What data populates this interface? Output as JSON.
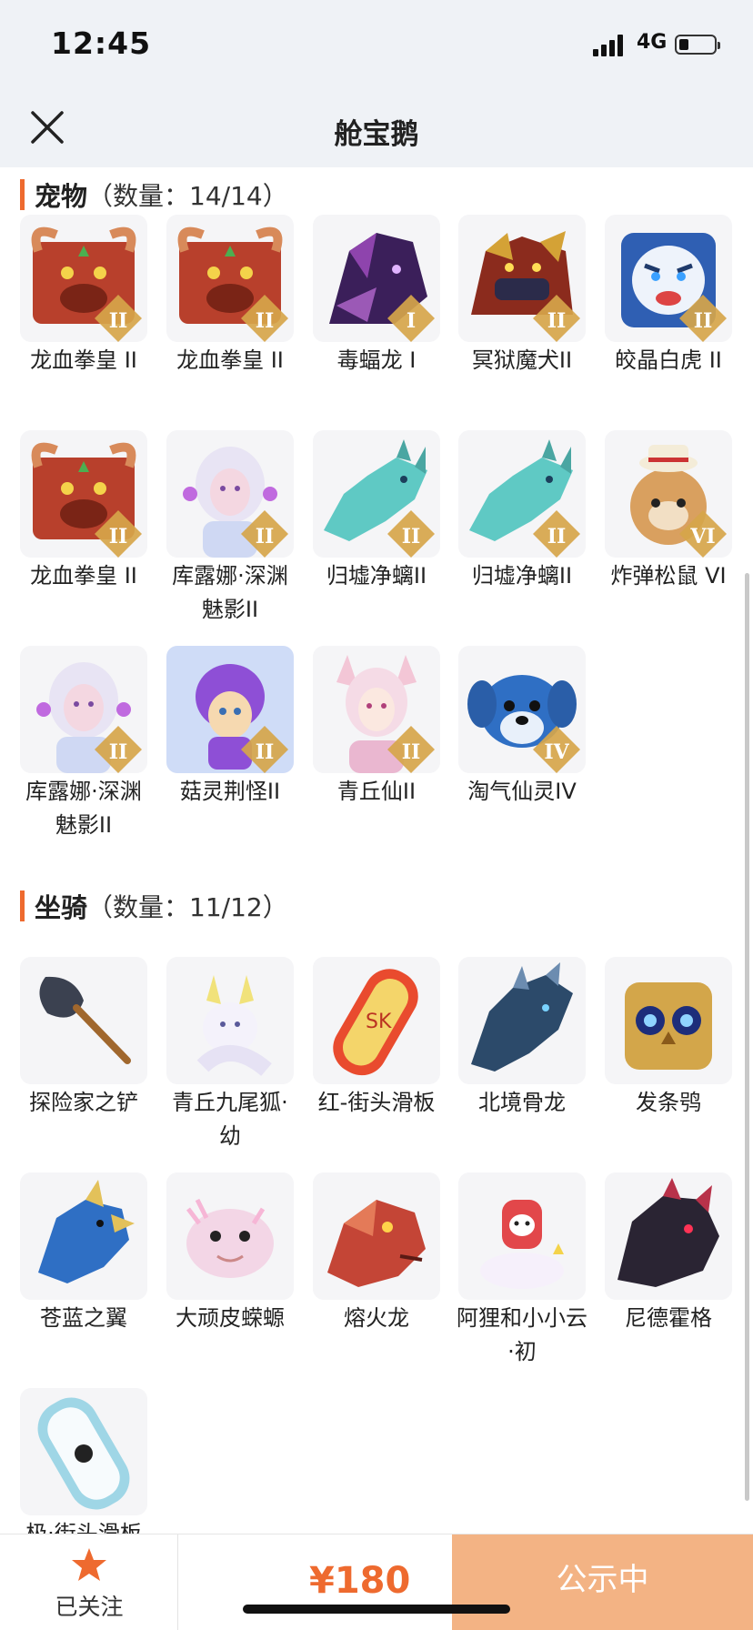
{
  "status_bar": {
    "time": "12:45",
    "network": "4G"
  },
  "header": {
    "title": "舱宝鹅"
  },
  "pets": {
    "title": "宠物",
    "count": "（数量：14/14）",
    "items": [
      {
        "label": "龙血拳皇 II",
        "rank": "II",
        "icon": "red-horned-beast"
      },
      {
        "label": "龙血拳皇 II",
        "rank": "II",
        "icon": "red-horned-beast"
      },
      {
        "label": "毒蝠龙 I",
        "rank": "I",
        "icon": "purple-bat-dragon"
      },
      {
        "label": "冥狱魔犬II",
        "rank": "II",
        "icon": "hell-hound"
      },
      {
        "label": "皎晶白虎 II",
        "rank": "II",
        "icon": "white-tiger"
      },
      {
        "label": "龙血拳皇 II",
        "rank": "II",
        "icon": "red-horned-beast"
      },
      {
        "label": "库露娜·深渊魅影II",
        "rank": "II",
        "icon": "white-hair-girl"
      },
      {
        "label": "归墟净螭II",
        "rank": "II",
        "icon": "teal-dragon"
      },
      {
        "label": "归墟净螭II",
        "rank": "II",
        "icon": "teal-dragon"
      },
      {
        "label": "炸弹松鼠 VI",
        "rank": "VI",
        "icon": "squirrel-with-hat"
      },
      {
        "label": "库露娜·深渊魅影II",
        "rank": "II",
        "icon": "white-hair-girl"
      },
      {
        "label": "菇灵荆怪II",
        "rank": "II",
        "icon": "purple-hair-sprite"
      },
      {
        "label": "青丘仙II",
        "rank": "II",
        "icon": "fox-fairy"
      },
      {
        "label": "淘气仙灵IV",
        "rank": "IV",
        "icon": "blue-puppy"
      }
    ]
  },
  "mounts": {
    "title": "坐骑",
    "count": "（数量：11/12）",
    "items": [
      {
        "label": "探险家之铲",
        "icon": "shovel"
      },
      {
        "label": "青丘九尾狐·幼",
        "icon": "white-fox"
      },
      {
        "label": "红-街头滑板",
        "icon": "red-skateboard"
      },
      {
        "label": "北境骨龙",
        "icon": "bone-dragon"
      },
      {
        "label": "发条鸮",
        "icon": "clockwork-owl"
      },
      {
        "label": "苍蓝之翼",
        "icon": "blue-eagle"
      },
      {
        "label": "大顽皮蝾螈",
        "icon": "pink-axolotl"
      },
      {
        "label": "熔火龙",
        "icon": "magma-dragon"
      },
      {
        "label": "阿狸和小小云·初",
        "icon": "ali-on-cloud"
      },
      {
        "label": "尼德霍格",
        "icon": "dark-dragon"
      },
      {
        "label": "极·街头滑板",
        "icon": "white-skateboard"
      }
    ]
  },
  "footer": {
    "follow_label": "已关注",
    "price": "¥180",
    "status_button": "公示中"
  },
  "colors": {
    "accent": "#ee6a2f",
    "status_button_bg": "#f3b384",
    "header_bg": "#eff2f6",
    "tile_bg": "#f5f5f7"
  }
}
